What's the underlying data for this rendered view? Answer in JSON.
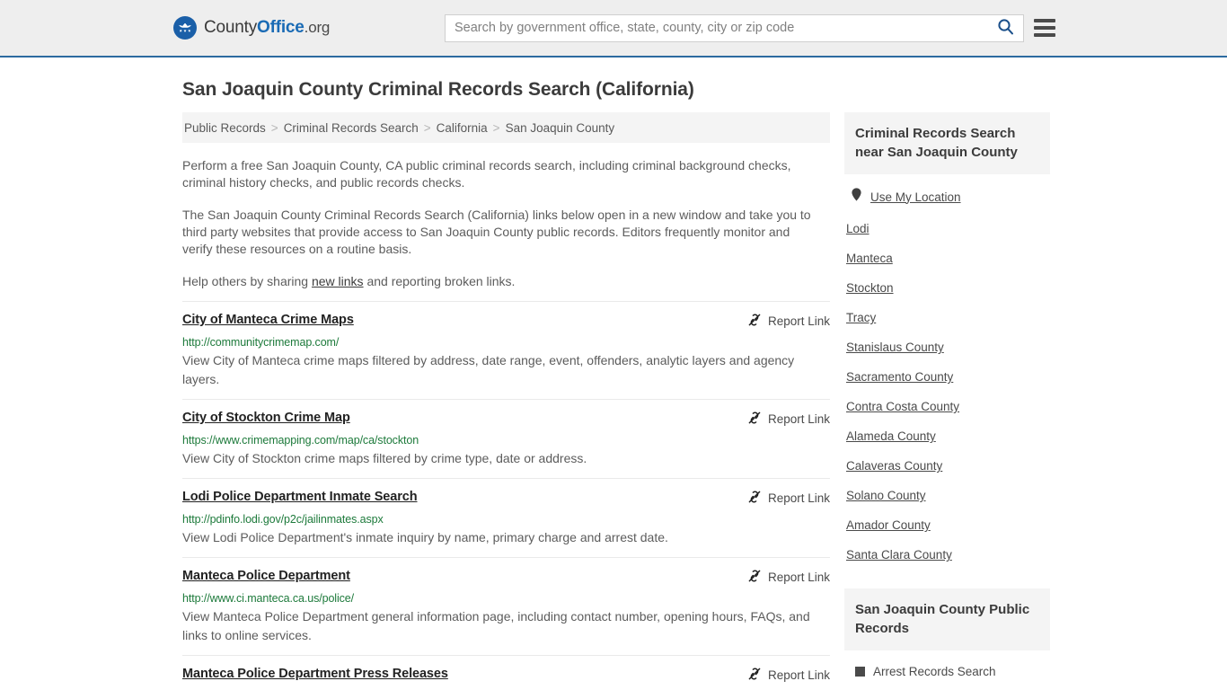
{
  "header": {
    "brand": {
      "part1": "County",
      "part2": "Office",
      "part3": ".org",
      "logo_icon": "eagle-stars-emblem"
    },
    "search": {
      "placeholder": "Search by government office, state, county, city or zip code",
      "value": "",
      "search_icon": "search-icon"
    },
    "menu_icon": "hamburger-menu-icon"
  },
  "page": {
    "title": "San Joaquin County Criminal Records Search (California)"
  },
  "breadcrumb": {
    "separator": ">",
    "items": [
      {
        "label": "Public Records"
      },
      {
        "label": "Criminal Records Search"
      },
      {
        "label": "California"
      },
      {
        "label": "San Joaquin County"
      }
    ]
  },
  "intro": {
    "p1": "Perform a free San Joaquin County, CA public criminal records search, including criminal background checks, criminal history checks, and public records checks.",
    "p2": "The San Joaquin County Criminal Records Search (California) links below open in a new window and take you to third party websites that provide access to San Joaquin County public records. Editors frequently monitor and verify these resources on a routine basis.",
    "p3_before": "Help others by sharing ",
    "p3_link": "new links",
    "p3_after": " and reporting broken links."
  },
  "results": {
    "report_label": "Report Link",
    "report_icon": "broken-link-icon",
    "items": [
      {
        "title": "City of Manteca Crime Maps",
        "url": "http://communitycrimemap.com/",
        "description": "View City of Manteca crime maps filtered by address, date range, event, offenders, analytic layers and agency layers."
      },
      {
        "title": "City of Stockton Crime Map",
        "url": "https://www.crimemapping.com/map/ca/stockton",
        "description": "View City of Stockton crime maps filtered by crime type, date or address."
      },
      {
        "title": "Lodi Police Department Inmate Search",
        "url": "http://pdinfo.lodi.gov/p2c/jailinmates.aspx",
        "description": "View Lodi Police Department's inmate inquiry by name, primary charge and arrest date."
      },
      {
        "title": "Manteca Police Department",
        "url": "http://www.ci.manteca.ca.us/police/",
        "description": "View Manteca Police Department general information page, including contact number, opening hours, FAQs, and links to online services."
      },
      {
        "title": "Manteca Police Department Press Releases",
        "url": "",
        "description": ""
      }
    ]
  },
  "sidebar": {
    "nearby": {
      "title": "Criminal Records Search near San Joaquin County",
      "use_my_location": "Use My Location",
      "location_icon": "map-pin-icon",
      "links": [
        {
          "label": "Lodi"
        },
        {
          "label": "Manteca"
        },
        {
          "label": "Stockton"
        },
        {
          "label": "Tracy"
        },
        {
          "label": "Stanislaus County"
        },
        {
          "label": "Sacramento County"
        },
        {
          "label": "Contra Costa County"
        },
        {
          "label": "Alameda County"
        },
        {
          "label": "Calaveras County"
        },
        {
          "label": "Solano County"
        },
        {
          "label": "Amador County"
        },
        {
          "label": "Santa Clara County"
        }
      ]
    },
    "public_records": {
      "title": "San Joaquin County Public Records",
      "items": [
        {
          "label": "Arrest Records Search"
        }
      ]
    }
  }
}
